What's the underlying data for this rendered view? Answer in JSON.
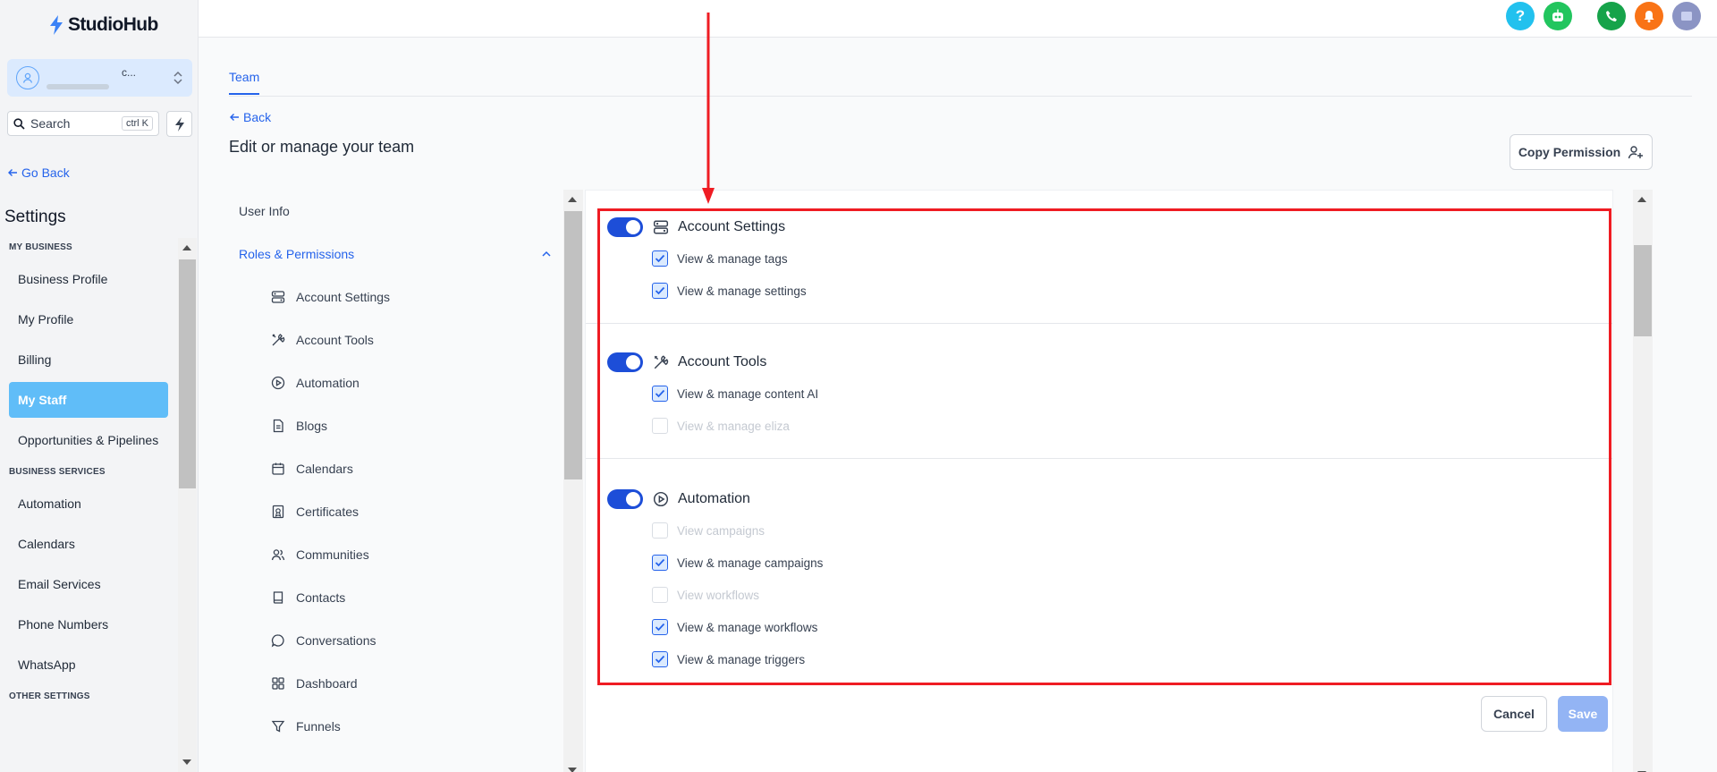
{
  "app": {
    "name": "StudioHub"
  },
  "account": {
    "name_initial": "c..."
  },
  "search": {
    "label": "Search",
    "shortcut": "ctrl K"
  },
  "sidebar": {
    "go_back": "Go Back",
    "title": "Settings",
    "sections": [
      {
        "label": "MY BUSINESS",
        "items": [
          "Business Profile",
          "My Profile",
          "Billing",
          "My Staff",
          "Opportunities & Pipelines"
        ]
      },
      {
        "label": "BUSINESS SERVICES",
        "items": [
          "Automation",
          "Calendars",
          "Email Services",
          "Phone Numbers",
          "WhatsApp"
        ]
      },
      {
        "label": "OTHER SETTINGS",
        "items": []
      }
    ],
    "active_item": "My Staff"
  },
  "topbar": {
    "icons": [
      {
        "name": "help-icon",
        "glyph": "?",
        "color": "#22c1ee"
      },
      {
        "name": "bot-icon",
        "glyph": "",
        "color": "#22c55e"
      },
      {
        "name": "phone-icon",
        "glyph": "",
        "color": "#16a34a"
      },
      {
        "name": "bell-icon",
        "glyph": "",
        "color": "#f97316"
      },
      {
        "name": "avatar-icon",
        "glyph": "",
        "color": "#8b94c4"
      }
    ]
  },
  "main": {
    "tab": "Team",
    "back": "Back",
    "title": "Edit or manage your team",
    "copy_permission": "Copy Permission",
    "subnav": {
      "user_info": "User Info",
      "roles": "Roles & Permissions",
      "children": [
        {
          "label": "Account Settings",
          "icon": "account-settings-icon"
        },
        {
          "label": "Account Tools",
          "icon": "tools-icon"
        },
        {
          "label": "Automation",
          "icon": "play-circle-icon"
        },
        {
          "label": "Blogs",
          "icon": "document-icon"
        },
        {
          "label": "Calendars",
          "icon": "calendar-icon"
        },
        {
          "label": "Certificates",
          "icon": "certificate-icon"
        },
        {
          "label": "Communities",
          "icon": "users-icon"
        },
        {
          "label": "Contacts",
          "icon": "book-icon"
        },
        {
          "label": "Conversations",
          "icon": "chat-icon"
        },
        {
          "label": "Dashboard",
          "icon": "dashboard-icon"
        },
        {
          "label": "Funnels",
          "icon": "funnel-icon"
        }
      ]
    },
    "groups": [
      {
        "title": "Account Settings",
        "icon": "account-settings-icon",
        "enabled": true,
        "perms": [
          {
            "label": "View & manage tags",
            "checked": true,
            "disabled": false
          },
          {
            "label": "View & manage settings",
            "checked": true,
            "disabled": false
          }
        ]
      },
      {
        "title": "Account Tools",
        "icon": "tools-icon",
        "enabled": true,
        "perms": [
          {
            "label": "View & manage content AI",
            "checked": true,
            "disabled": false
          },
          {
            "label": "View & manage eliza",
            "checked": false,
            "disabled": true
          }
        ]
      },
      {
        "title": "Automation",
        "icon": "play-circle-icon",
        "enabled": true,
        "perms": [
          {
            "label": "View campaigns",
            "checked": false,
            "disabled": true
          },
          {
            "label": "View & manage campaigns",
            "checked": true,
            "disabled": false
          },
          {
            "label": "View workflows",
            "checked": false,
            "disabled": true
          },
          {
            "label": "View & manage workflows",
            "checked": true,
            "disabled": false
          },
          {
            "label": "View & manage triggers",
            "checked": true,
            "disabled": false
          }
        ]
      }
    ],
    "cancel": "Cancel",
    "save": "Save"
  },
  "colors": {
    "accent": "#2563eb",
    "active_nav": "#60bdf8",
    "toggle": "#1d4ed8",
    "annotation": "#ef1c23"
  }
}
